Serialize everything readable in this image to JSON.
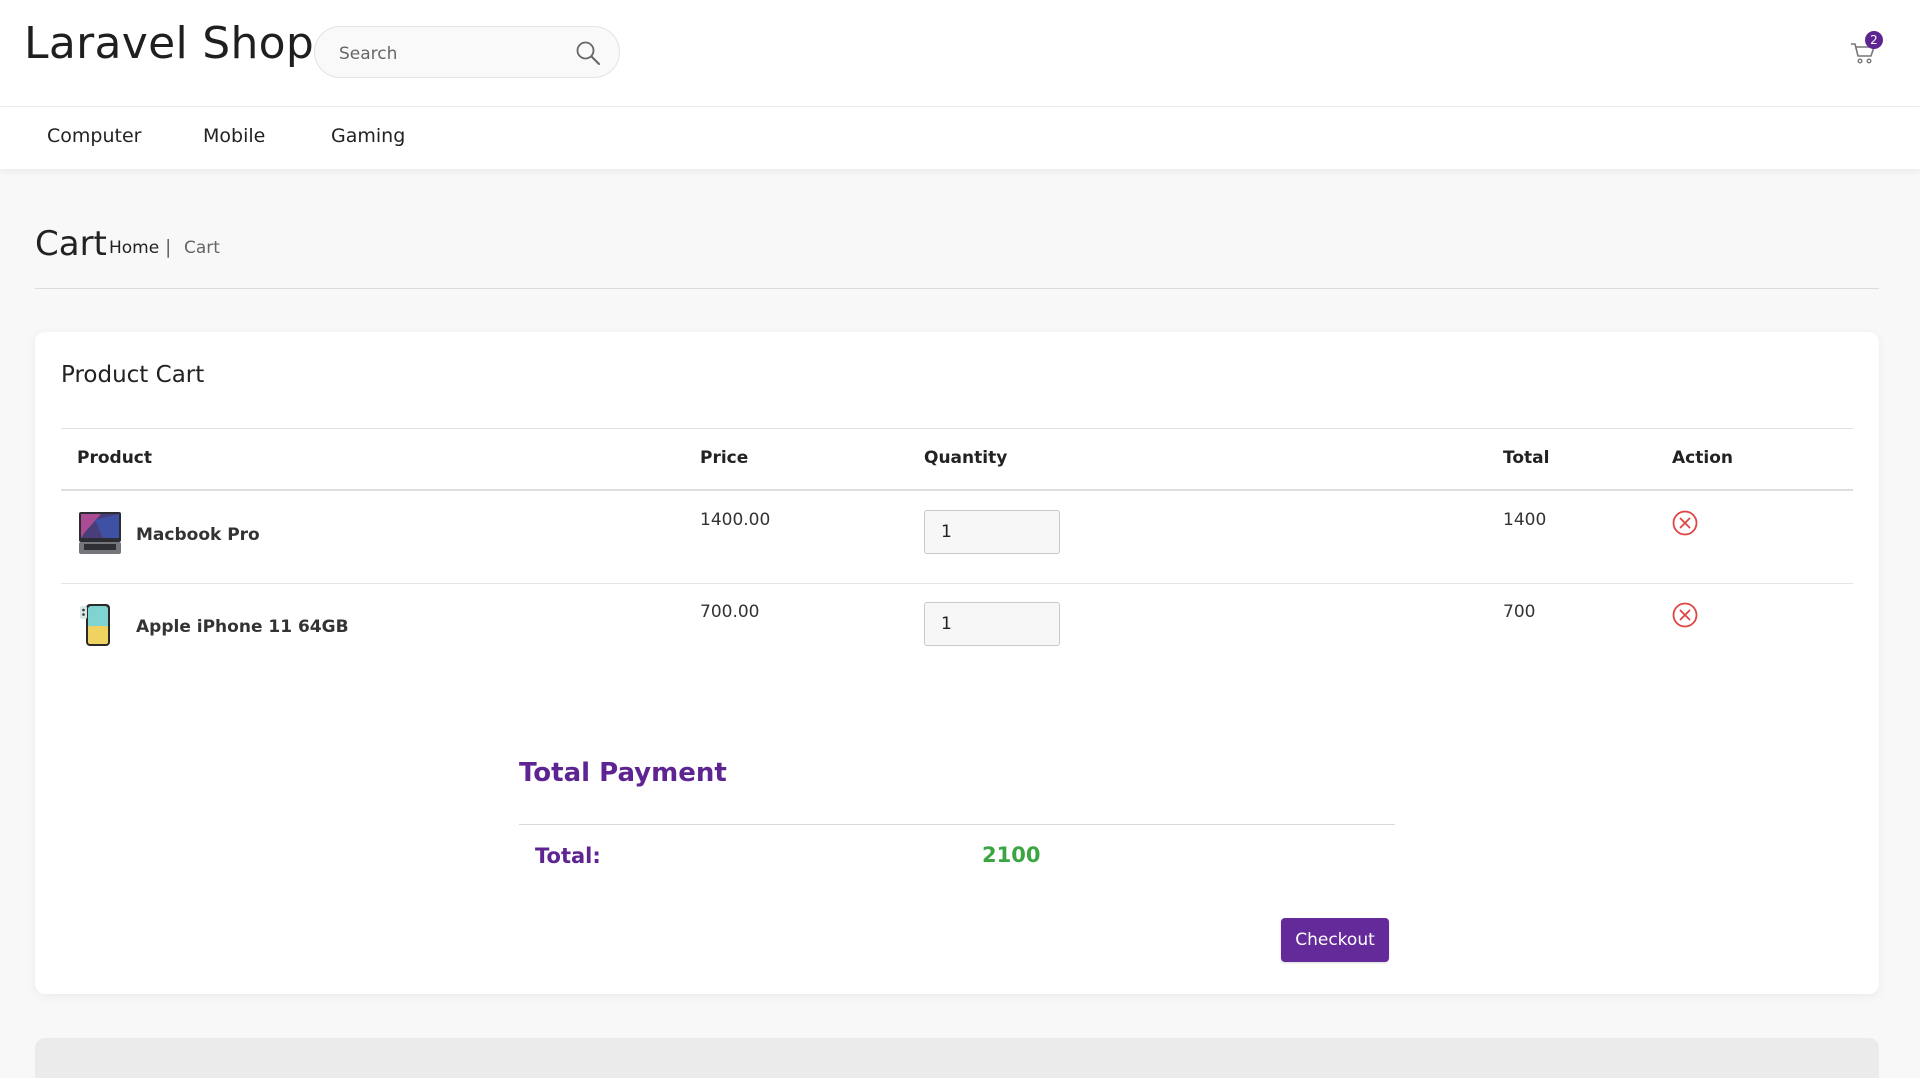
{
  "header": {
    "logo": "Laravel Shop",
    "search": {
      "placeholder": "Search",
      "value": ""
    },
    "cart_count": "2"
  },
  "nav": {
    "items": [
      {
        "label": "Computer"
      },
      {
        "label": "Mobile"
      },
      {
        "label": "Gaming"
      }
    ]
  },
  "page": {
    "title": "Cart",
    "breadcrumb": {
      "home": "Home",
      "separator": "|",
      "current": "Cart"
    }
  },
  "cart": {
    "title": "Product Cart",
    "columns": [
      "Product",
      "Price",
      "Quantity",
      "Total",
      "Action"
    ],
    "rows": [
      {
        "product": "Macbook Pro",
        "price": "1400.00",
        "quantity": "1",
        "total": "1400",
        "icon": "laptop-image"
      },
      {
        "product": "Apple iPhone 11 64GB",
        "price": "700.00",
        "quantity": "1",
        "total": "700",
        "icon": "phone-image"
      }
    ],
    "summary": {
      "heading": "Total Payment",
      "label": "Total:",
      "value": "2100",
      "checkout_label": "Checkout"
    }
  },
  "colors": {
    "accent": "#5e2592",
    "button": "#652a9a",
    "total_value": "#3aa541",
    "remove_icon": "#e04545"
  }
}
